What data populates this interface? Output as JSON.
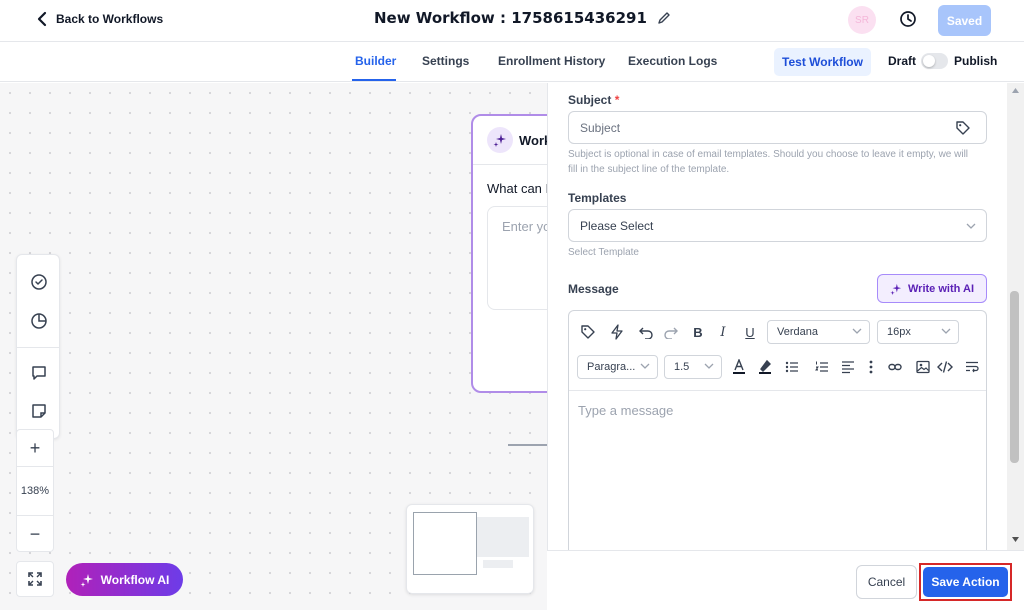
{
  "header": {
    "back_label": "Back to Workflows",
    "title": "New Workflow : 1758615436291",
    "avatar_initials": "SR",
    "saved_label": "Saved"
  },
  "tabs": [
    {
      "label": "Builder",
      "active": true
    },
    {
      "label": "Settings",
      "active": false
    },
    {
      "label": "Enrollment History",
      "active": false
    },
    {
      "label": "Execution Logs",
      "active": false
    }
  ],
  "tab_actions": {
    "test_label": "Test Workflow",
    "draft_label": "Draft",
    "publish_label": "Publish",
    "published": false
  },
  "canvas": {
    "node_title": "Workflow AI",
    "node_prompt": "What can I help you with?",
    "node_input_placeholder": "Enter your prompt",
    "zoom_level": "138%",
    "zoom_in": "+",
    "zoom_out": "−",
    "workflow_ai_label": "Workflow AI"
  },
  "panel": {
    "subject_label": "Subject",
    "required_mark": "*",
    "subject_placeholder": "Subject",
    "subject_help": "Subject is optional in case of email templates. Should you choose to leave it empty, we will fill in the subject line of the template.",
    "templates_label": "Templates",
    "templates_placeholder": "Please Select",
    "templates_help": "Select Template",
    "message_label": "Message",
    "write_ai_label": "Write with AI",
    "editor": {
      "font_family": "Verdana",
      "font_size": "16px",
      "paragraph": "Paragra...",
      "line_height": "1.5",
      "message_placeholder": "Type a message"
    }
  },
  "footer": {
    "cancel_label": "Cancel",
    "save_label": "Save Action"
  },
  "colors": {
    "accent": "#2563eb",
    "ai_gradient_start": "#b021b9",
    "ai_gradient_end": "#6d3ce8",
    "highlight_outline": "#d62828"
  }
}
